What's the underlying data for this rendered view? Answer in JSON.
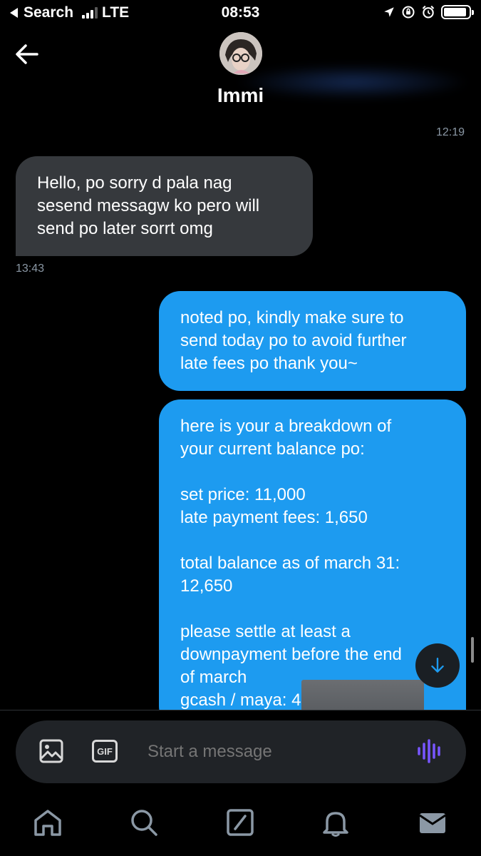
{
  "status_bar": {
    "back_app": "Search",
    "carrier": "LTE",
    "time": "08:53",
    "battery_level": 0.9
  },
  "header": {
    "contact_name": "Immi",
    "back_icon": "back-arrow-icon"
  },
  "messages": [
    {
      "direction": "outgoing",
      "text": "",
      "timestamp": "12:19",
      "partial": true
    },
    {
      "direction": "incoming",
      "text": "Hello, po sorry d pala nag\nsesend messagw ko pero will\nsend po later sorrt omg",
      "timestamp": "13:43"
    },
    {
      "direction": "outgoing",
      "text": "noted po, kindly make sure to\nsend today po to avoid further\nlate fees po thank you~"
    },
    {
      "direction": "outgoing",
      "text": "here is your a breakdown of\nyour current balance po:\n\nset price: 11,000\nlate payment fees: 1,650\n\ntotal balance as of march 31:\n12,650\n\nplease settle at least a\ndownpayment before the end\nof march\ngcash / maya: 4 -"
    }
  ],
  "composer": {
    "placeholder": "Start a message",
    "gif_label": "GIF"
  },
  "nav": [
    "home-icon",
    "search-icon",
    "compose-icon",
    "notifications-icon",
    "messages-icon"
  ],
  "colors": {
    "accent": "#1d9bf0",
    "incoming_bubble": "#36393d",
    "background": "#000000",
    "voice_icon": "#7856ff"
  }
}
